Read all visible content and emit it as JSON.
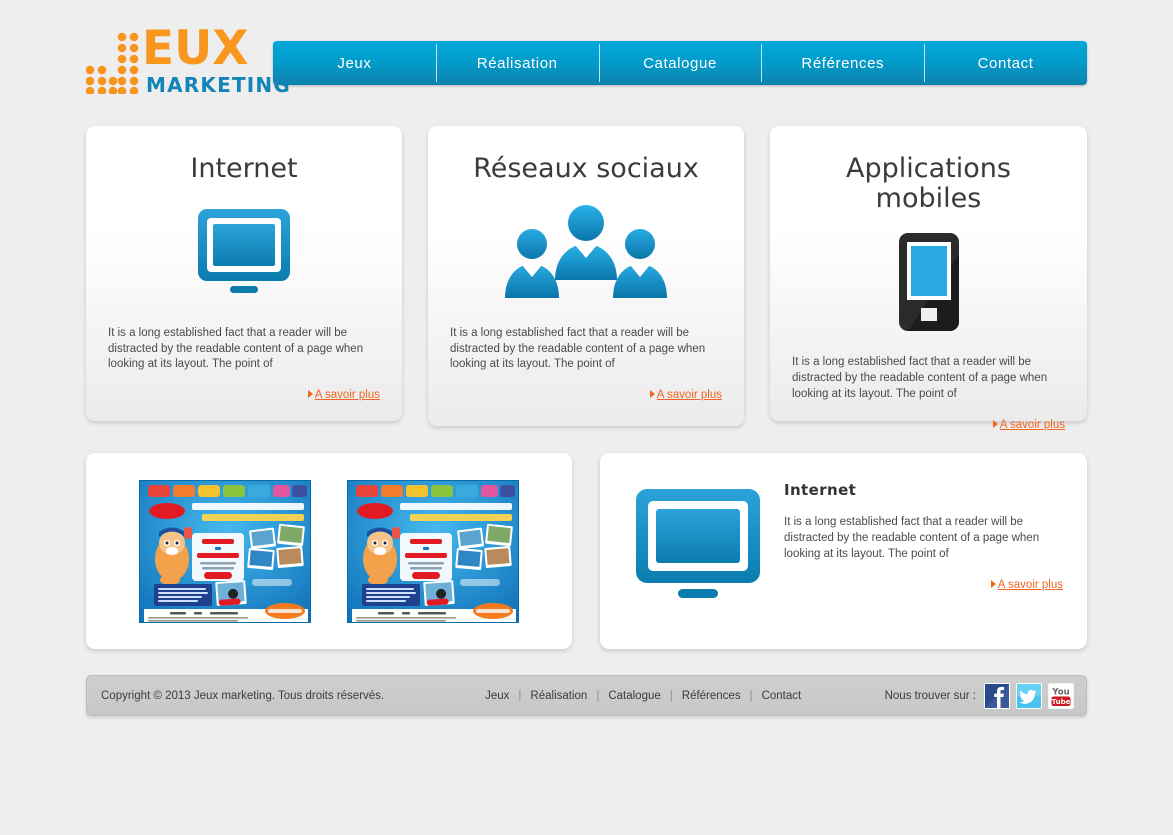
{
  "brand": {
    "logo_main": "EUX",
    "logo_sub": "MARKETING",
    "logo_j_icon": "dotted-j-icon",
    "orange": "#f8961e",
    "blue": "#1383b8"
  },
  "nav": {
    "items": [
      {
        "label": "Jeux",
        "name": "nav-item-jeux"
      },
      {
        "label": "Réalisation",
        "name": "nav-item-realisation"
      },
      {
        "label": "Catalogue",
        "name": "nav-item-catalogue"
      },
      {
        "label": "Références",
        "name": "nav-item-references"
      },
      {
        "label": "Contact",
        "name": "nav-item-contact"
      }
    ],
    "accent": "#00a9da"
  },
  "cards": [
    {
      "title": "Internet",
      "icon": "monitor-icon",
      "body": "It is a long established fact that a reader will be distracted by the readable content of a page when looking at its layout. The point of",
      "link": "A savoir plus"
    },
    {
      "title": "Réseaux sociaux",
      "icon": "people-group-icon",
      "body": "It is a long established fact that a reader will be distracted by the readable content of a page when looking at its layout. The point of",
      "link": "A savoir plus"
    },
    {
      "title": "Applications mobiles",
      "icon": "smartphone-icon",
      "body": "It is a long established fact that a reader will be distracted by the readable content of a page when looking at its layout. The point of",
      "link": "A savoir plus"
    }
  ],
  "gallery": {
    "thumbnails": [
      {
        "name": "thumbnail-kelloggs-1",
        "brand": "Kellogg's",
        "headline_1": "1 P'tit Déj PAR JOUR à gagner",
        "headline_2": "dans un endroit incroyable !",
        "box_line_1": "1 code",
        "box_line_2": "=",
        "box_line_3": "1 chance de gagner",
        "button": "Je rentre mon code"
      },
      {
        "name": "thumbnail-kelloggs-2",
        "brand": "Kellogg's",
        "headline_1": "1 P'tit Déj PAR JOUR à gagner",
        "headline_2": "dans un endroit incroyable !",
        "box_line_1": "1 code",
        "box_line_2": "=",
        "box_line_3": "1 chance de gagner",
        "button": "Je rentre mon code"
      }
    ]
  },
  "feature": {
    "icon": "monitor-icon",
    "title": "Internet",
    "body": "It is a long established fact that a reader will be distracted by the readable content of a page when looking at its layout. The point of",
    "link": "A savoir plus"
  },
  "footer": {
    "copyright": "Copyright © 2013 Jeux marketing. Tous droits réservés.",
    "links": [
      "Jeux",
      "Réalisation",
      "Catalogue",
      "Références",
      "Contact"
    ],
    "separator": "|",
    "social_label": "Nous trouver sur :",
    "social": [
      {
        "name": "facebook-icon",
        "label": "f"
      },
      {
        "name": "twitter-icon",
        "label": "t"
      },
      {
        "name": "youtube-icon",
        "label": "You Tube"
      }
    ]
  }
}
